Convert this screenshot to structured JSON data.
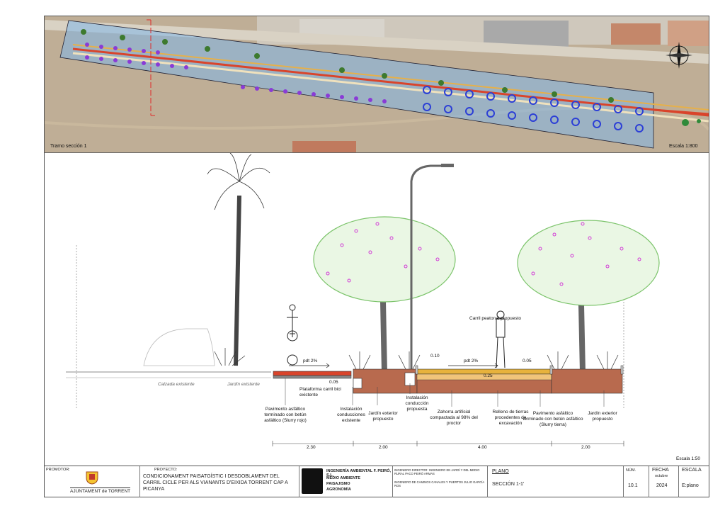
{
  "aerial": {
    "section_label": "Tramo sección 1",
    "scale_label": "Escala 1:800"
  },
  "section": {
    "scale": "Escala 1:50",
    "labels": {
      "calzada": "Calzada existente",
      "jardin_existente": "Jardín existente",
      "carril_peatonal": "Carril peatonal propuesto",
      "pdt1": "pdt 2%",
      "pdt2": "pdt 2%",
      "v005a": "0.05",
      "v010": "0.10",
      "v005b": "0.05",
      "v025": "0.25"
    },
    "annotations": {
      "plataforma": "Plataforma carril bici existente",
      "pavimento_rojo": "Pavimento asfáltico terminado con betún asfáltico (Slurry rojo)",
      "conducciones_exist": "Instalación conducciones existente",
      "conduccion_prop": "Instalación conducción propuesta",
      "jardin1": "Jardín exterior propuesto",
      "zahorra": "Zahorra artificial compactada al 98% del proctor",
      "relleno": "Relleno de tierras procedentes de excavación",
      "pavimento_tierra": "Pavimento asfáltico terminado con betún asfáltico (Slurry tierra)",
      "jardin2": "Jardín exterior propuesto"
    },
    "dims": [
      "2.30",
      "2.00",
      "4.00",
      "2.00"
    ]
  },
  "title_block": {
    "promotor_label": "PROMOTOR:",
    "ayuntamiento": "AJUNTAMENT de TORRENT",
    "proyecto_label": "PROYECTO:",
    "proyecto": "CONDICIONAMENT PAISATGÍSTIC I DESDOBLAMENT DEL CARRIL CICLE PER ALS VIANANTS D'EIXIDA TORRENT CAP A PICANYA",
    "firm_name": "INGENIERÍA AMBIENTAL F. PEIRÓ, S.L.",
    "firm_lines": [
      "MEDIO AMBIENTE",
      "PAISAJISMO",
      "AGRONOMÍA"
    ],
    "director_1": "INGENIERO DIRECTOR: INGENIERO EN JARDÍ Y DEL MEDIO RURAL PACO PEIRÓ ARMAS",
    "director_2": "INGENIERO DE CAMINOS CANALES Y PUERTOS JULIO GARCÍA ROS",
    "plano_label": "PLANO",
    "plano": "SECCIÓN 1-1'",
    "num_label": "NÚM.",
    "num": "10.1",
    "fecha_label": "FECHA",
    "fecha_month": "octubre",
    "fecha_year": "2024",
    "escala_label": "ESCALA",
    "escala": "E:plano"
  },
  "colors": {
    "bike_lane": "#d9442b",
    "sidewalk": "#e7b23c",
    "soil": "#b86a4e",
    "tree_foliage": "#7cc46b",
    "flower": "#d23bd6",
    "overlay": "#7fb6ea"
  }
}
